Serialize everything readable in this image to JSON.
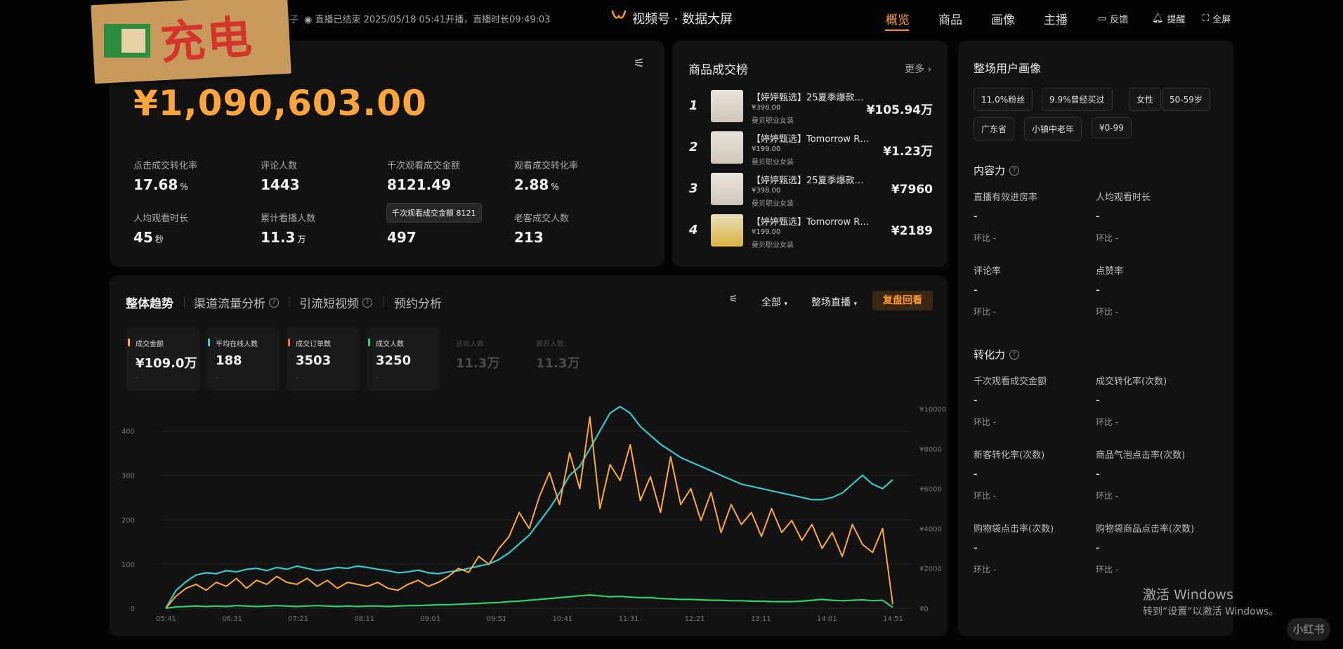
{
  "header": {
    "status": "◉ 直播已结束 2025/05/18 05:41开播，直播时长09:49:03",
    "status_prefix": "子",
    "title": "视频号 · 数据大屏",
    "nav": [
      "概览",
      "商品",
      "画像",
      "主播"
    ],
    "actions": {
      "feedback": "反馈",
      "remind": "提醒",
      "fullscreen": "全屏"
    }
  },
  "sticker": {
    "text": "充电"
  },
  "overview": {
    "amount": "¥1,090,603.00",
    "metrics": [
      {
        "label": "点击成交转化率",
        "value": "17.68",
        "unit": "%"
      },
      {
        "label": "评论人数",
        "value": "1443",
        "unit": ""
      },
      {
        "label": "千次观看成交金额",
        "value": "8121.49",
        "unit": ""
      },
      {
        "label": "观看成交转化率",
        "value": "2.88",
        "unit": "%"
      },
      {
        "label": "人均观看时长",
        "value": "45",
        "unit": "秒"
      },
      {
        "label": "累计看播人数",
        "value": "11.3",
        "unit": "万"
      },
      {
        "label": "",
        "value": "497",
        "unit": ""
      },
      {
        "label": "老客成交人数",
        "value": "213",
        "unit": ""
      }
    ],
    "tooltip": "千次观看成交金额 8121"
  },
  "ranking": {
    "title": "商品成交榜",
    "more": "更多",
    "items": [
      {
        "rank": "1",
        "name": "【婷婷甄选】25夏季爆款…",
        "price": "¥398.00",
        "shop": "曼贝职业女装",
        "amount": "¥105.94万"
      },
      {
        "rank": "2",
        "name": "【婷婷甄选】Tomorrow R…",
        "price": "¥199.00",
        "shop": "曼贝职业女装",
        "amount": "¥1.23万"
      },
      {
        "rank": "3",
        "name": "【婷婷甄选】25夏季爆款…",
        "price": "¥398.00",
        "shop": "曼贝职业女装",
        "amount": "¥7960"
      },
      {
        "rank": "4",
        "name": "【婷婷甄选】Tomorrow R…",
        "price": "¥199.00",
        "shop": "曼贝职业女装",
        "amount": "¥2189"
      }
    ]
  },
  "profile": {
    "title": "整场用户画像",
    "tags": [
      "11.0%粉丝",
      "9.9%曾经买过",
      "女性",
      "50-59岁",
      "广东省",
      "小镇中老年",
      "¥0-99"
    ],
    "sections": [
      {
        "title": "内容力",
        "items": [
          {
            "label": "直播有效进房率",
            "value": "-",
            "cmp": "环比 -"
          },
          {
            "label": "人均观看时长",
            "value": "-",
            "cmp": "环比 -"
          },
          {
            "label": "评论率",
            "value": "-",
            "cmp": "环比 -"
          },
          {
            "label": "点赞率",
            "value": "-",
            "cmp": "环比 -"
          }
        ]
      },
      {
        "title": "转化力",
        "items": [
          {
            "label": "千次观看成交金额",
            "value": "-",
            "cmp": "环比 -"
          },
          {
            "label": "成交转化率(次数)",
            "value": "-",
            "cmp": "环比 -"
          },
          {
            "label": "新客转化率(次数)",
            "value": "-",
            "cmp": "环比 -"
          },
          {
            "label": "商品气泡点击率(次数)",
            "value": "-",
            "cmp": "环比 -"
          },
          {
            "label": "购物袋点击率(次数)",
            "value": "-",
            "cmp": "环比 -"
          },
          {
            "label": "购物袋商品点击率(次数)",
            "value": "-",
            "cmp": "环比 -"
          }
        ]
      }
    ]
  },
  "trend": {
    "tabs": [
      "整体趋势",
      "渠道流量分析",
      "引流短视频",
      "预约分析"
    ],
    "controls": {
      "all": "全部",
      "scope": "整场直播",
      "replay": "复盘回看"
    },
    "cards": [
      {
        "label": "成交金额",
        "value": "¥109.0万",
        "color": "#ffa93a",
        "sub": "-",
        "dim": false
      },
      {
        "label": "平均在线人数",
        "value": "188",
        "color": "#37c8cf",
        "sub": "-",
        "dim": false
      },
      {
        "label": "成交订单数",
        "value": "3503",
        "color": "#ff6a4a",
        "sub": "-",
        "dim": false
      },
      {
        "label": "成交人数",
        "value": "3250",
        "color": "#2fcf6a",
        "sub": "-",
        "dim": false
      },
      {
        "label": "进房人数",
        "value": "11.3万",
        "color": "",
        "sub": "",
        "dim": true
      },
      {
        "label": "离开人数",
        "value": "11.3万",
        "color": "",
        "sub": "",
        "dim": true
      }
    ]
  },
  "chart_data": {
    "type": "line",
    "x_ticks": [
      "05:41",
      "06:31",
      "07:21",
      "08:11",
      "09:01",
      "09:51",
      "10:41",
      "11:31",
      "12:21",
      "13:11",
      "14:01",
      "14:51"
    ],
    "y_left_ticks": [
      "0",
      "100",
      "200",
      "300",
      "400"
    ],
    "y_right_ticks": [
      "¥0",
      "¥2000",
      "¥4000",
      "¥6000",
      "¥8000",
      "¥10000"
    ],
    "ylim_left": [
      0,
      450
    ],
    "ylim_right": [
      0,
      10000
    ],
    "grid": true,
    "series": [
      {
        "color": "#37c8cf",
        "axis": "left",
        "values": [
          0,
          40,
          60,
          75,
          80,
          78,
          85,
          82,
          88,
          90,
          85,
          92,
          88,
          95,
          90,
          85,
          88,
          92,
          90,
          95,
          92,
          88,
          85,
          80,
          82,
          86,
          80,
          78,
          82,
          85,
          90,
          95,
          100,
          110,
          125,
          145,
          165,
          195,
          225,
          260,
          300,
          320,
          360,
          400,
          440,
          455,
          440,
          410,
          390,
          370,
          355,
          340,
          330,
          320,
          310,
          300,
          290,
          280,
          275,
          270,
          265,
          260,
          255,
          250,
          245,
          245,
          250,
          260,
          280,
          300,
          280,
          270,
          290
        ]
      },
      {
        "color": "#ffa93a",
        "axis": "right",
        "values": [
          0,
          600,
          1000,
          1200,
          900,
          1300,
          1100,
          1500,
          1000,
          1400,
          1200,
          1600,
          1300,
          1200,
          1500,
          1100,
          1400,
          1000,
          1300,
          1200,
          1100,
          1300,
          1000,
          900,
          1200,
          1400,
          1100,
          1300,
          1600,
          2000,
          1800,
          2600,
          2200,
          3000,
          3600,
          4800,
          4000,
          5600,
          6800,
          5200,
          7800,
          6000,
          9600,
          5000,
          7200,
          6400,
          8200,
          5400,
          6600,
          4800,
          7600,
          5200,
          6000,
          4400,
          5800,
          3800,
          5200,
          4200,
          4800,
          3600,
          5000,
          3800,
          4400,
          3400,
          4200,
          3000,
          3800,
          2600,
          4200,
          3200,
          2800,
          4000,
          200
        ]
      },
      {
        "color": "#2fcf6a",
        "axis": "left",
        "values": [
          0,
          3,
          4,
          5,
          4,
          5,
          4,
          6,
          5,
          4,
          5,
          6,
          5,
          4,
          5,
          6,
          5,
          4,
          5,
          4,
          5,
          5,
          4,
          5,
          6,
          6,
          7,
          8,
          8,
          9,
          10,
          11,
          12,
          13,
          15,
          16,
          18,
          20,
          22,
          24,
          26,
          28,
          30,
          28,
          26,
          27,
          25,
          24,
          24,
          22,
          21,
          20,
          20,
          19,
          18,
          18,
          17,
          17,
          16,
          16,
          15,
          15,
          15,
          16,
          18,
          20,
          18,
          17,
          18,
          19,
          17,
          18,
          2
        ]
      }
    ]
  }
}
